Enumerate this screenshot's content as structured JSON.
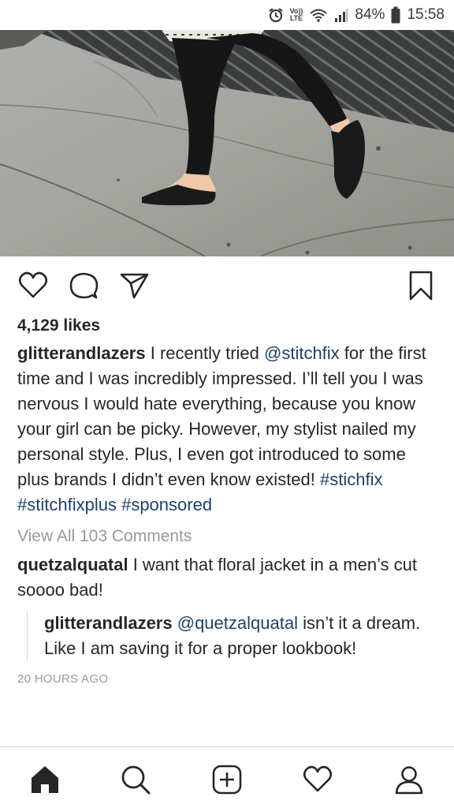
{
  "status_bar": {
    "volte_top": "Vo))",
    "volte_bottom": "LTE",
    "battery": "84%",
    "time": "15:58",
    "icons": [
      "alarm-icon",
      "volte-icon",
      "wifi-icon",
      "signal-icon",
      "battery-icon"
    ]
  },
  "post": {
    "likes": "4,129 likes",
    "caption": {
      "username": "glitterandlazers",
      "part1": " I recently tried ",
      "mention": "@stitchfix",
      "part2": " for the first time and I was incredibly impressed. I’ll tell you I was nervous I would hate everything, because you know your girl can be picky. However, my stylist nailed my personal style. Plus, I even got introduced to some plus brands I didn’t even know existed! ",
      "hashtag1": "#stichfix",
      "hashtag2": "#stitchfixplus",
      "hashtag3": "#sponsored"
    },
    "view_all_comments": "View All 103 Comments",
    "comment": {
      "username": "quetzalquatal",
      "text": " I want that floral jacket in a men’s cut soooo bad!"
    },
    "reply": {
      "username": "glitterandlazers",
      "mention": "@quetzalquatal",
      "text": " isn’t it a dream. Like I am saving it for a proper lookbook!"
    },
    "timestamp": "20 HOURS AGO"
  },
  "actions": [
    "heart-icon",
    "comment-icon",
    "share-icon",
    "bookmark-icon"
  ],
  "bottom_nav": [
    "home-icon",
    "search-icon",
    "add-post-icon",
    "activity-heart-icon",
    "profile-icon"
  ],
  "colors": {
    "link": "#1e3f6b",
    "muted": "#999999",
    "text": "#262626",
    "divider": "#dbdbdb"
  }
}
